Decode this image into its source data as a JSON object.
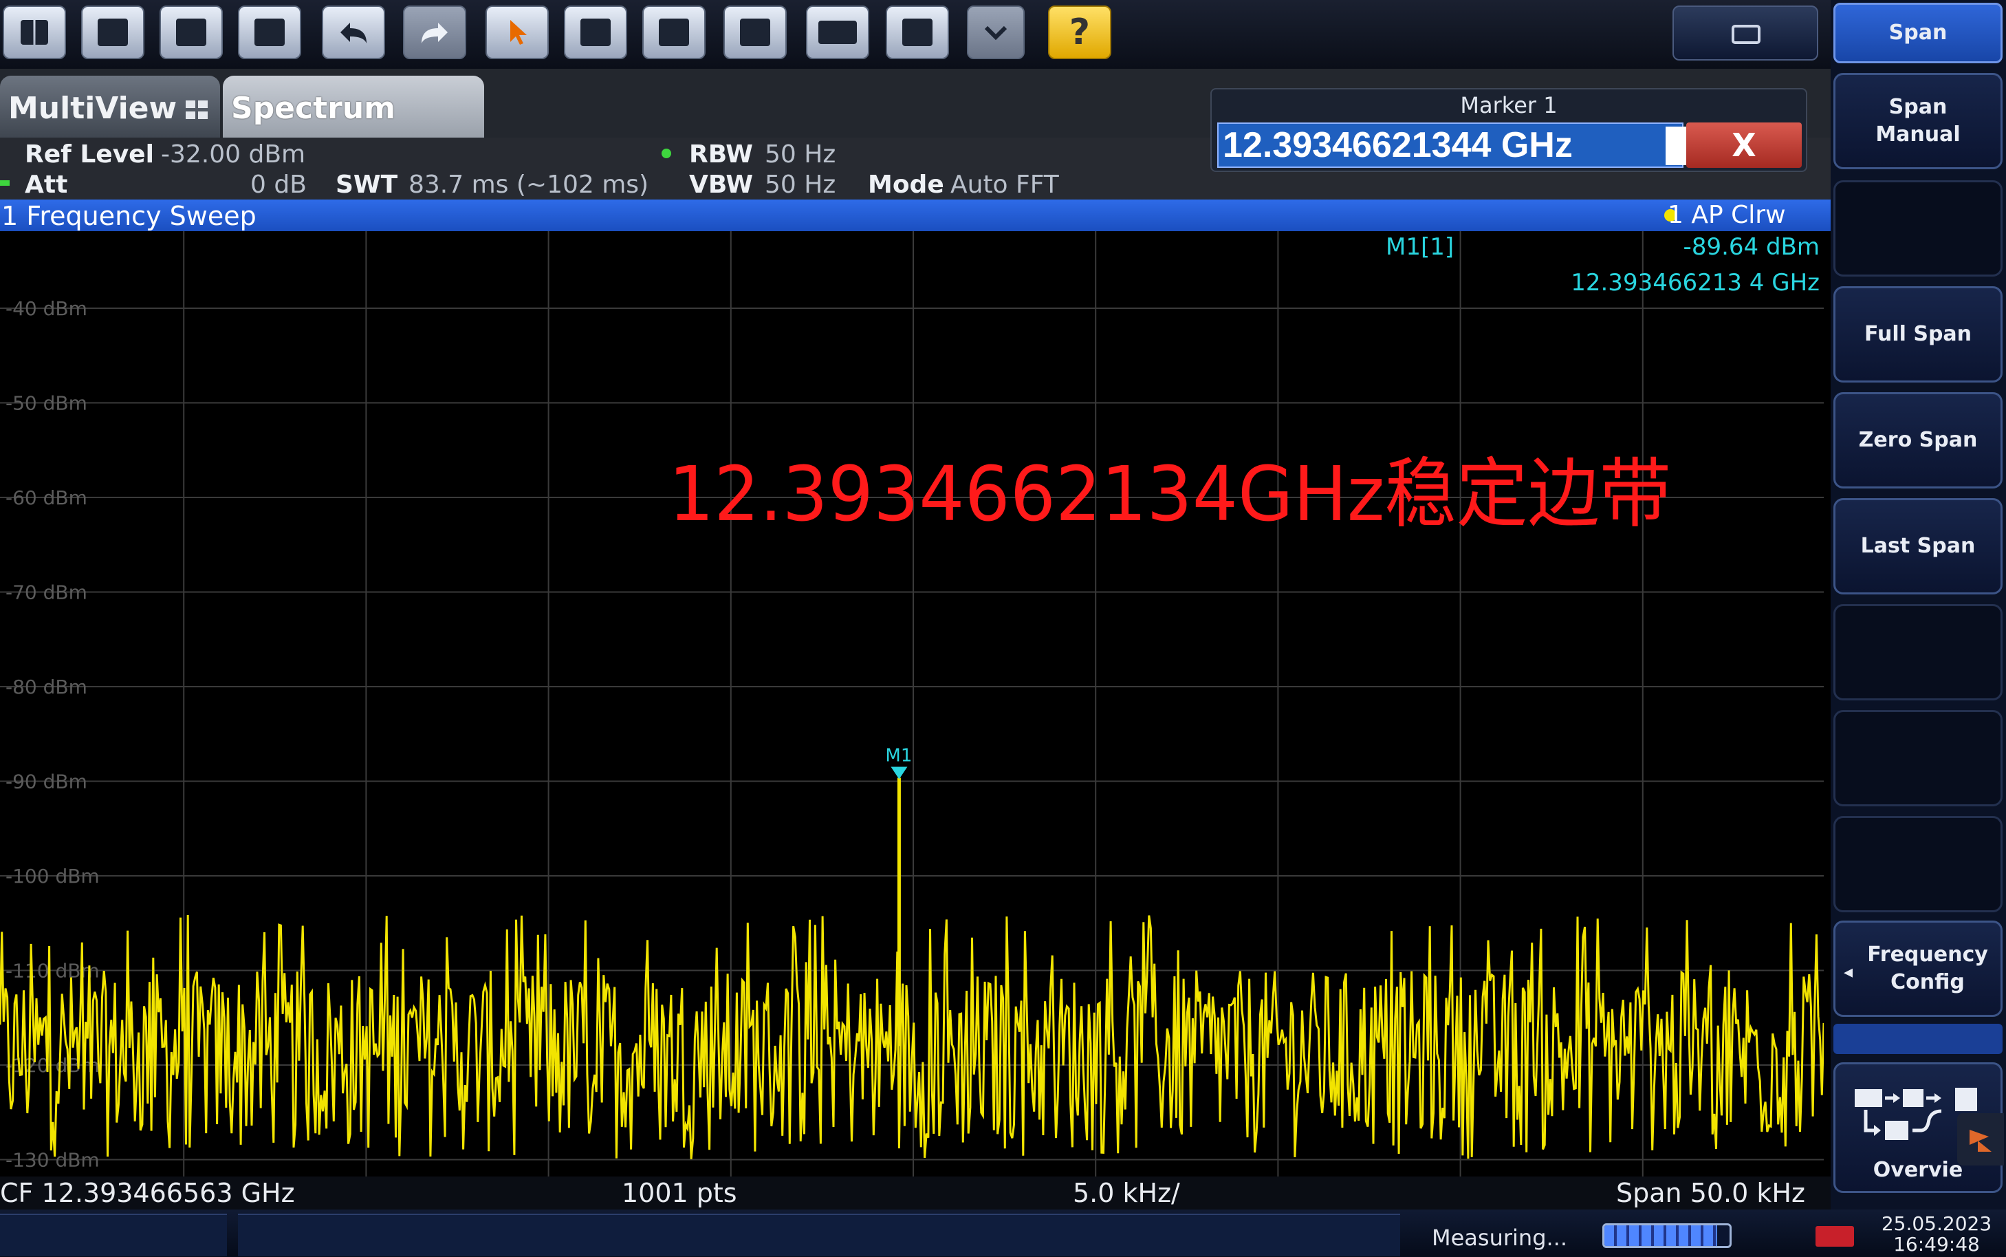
{
  "toolbar": {
    "buttons": [
      "windows-icon",
      "open-icon",
      "save-icon",
      "print-icon",
      "undo-icon",
      "redo-icon",
      "select-arrow-icon",
      "zoom-icon",
      "zoom-multi-icon",
      "zoom-off-icon",
      "keyboard-icon",
      "connect-icon",
      "more-icon",
      "help-icon"
    ]
  },
  "tabs": {
    "multiview": "MultiView",
    "spectrum": "Spectrum"
  },
  "marker_editor": {
    "title": "Marker 1",
    "value": "12.39346621344 GHz",
    "close": "X"
  },
  "settings": {
    "ref_level_label": "Ref Level",
    "ref_level_value": "-32.00 dBm",
    "att_label": "Att",
    "att_value": "0 dB",
    "swt_label": "SWT",
    "swt_value": "83.7 ms (~102 ms)",
    "rbw_label": "RBW",
    "rbw_value": "50 Hz",
    "vbw_label": "VBW",
    "vbw_value": "50 Hz",
    "mode_label": "Mode",
    "mode_value": "Auto FFT"
  },
  "window": {
    "title": "1 Frequency Sweep",
    "trace_info": "1 AP Clrw"
  },
  "marker_readout": {
    "name": "M1[1]",
    "level": "-89.64 dBm",
    "frequency": "12.393466213 4 GHz",
    "label_on_trace": "M1"
  },
  "annotation": "12.3934662134GHz稳定边带",
  "colors": {
    "trace": "#f2e400",
    "marker": "#2ad6e0",
    "annotation": "#ff1a1a",
    "title_bar": "#2461dd"
  },
  "chart_data": {
    "type": "line",
    "y_ticks": [
      "-40 dBm",
      "-50 dBm",
      "-60 dBm",
      "-70 dBm",
      "-80 dBm",
      "-90 dBm",
      "-100 dBm",
      "-110 dBm",
      "-120 dBm",
      "-130 dBm"
    ],
    "ylim": [
      -134,
      -32
    ],
    "xlim_khz": [
      -25,
      25
    ],
    "center_frequency": "12.393466563 GHz",
    "span": "50.0 kHz",
    "points": 1001,
    "peak": {
      "x_khz": -0.35,
      "y_dbm": -89.64
    },
    "noise_floor_dbm": [
      -130,
      -110
    ],
    "grid": true
  },
  "footer": {
    "cf": "CF 12.393466563 GHz",
    "pts": "1001 pts",
    "div": "5.0 kHz/",
    "span": "Span 50.0 kHz"
  },
  "softkeys": {
    "header": "Span",
    "span_manual": "Span Manual",
    "full_span": "Full Span",
    "zero_span": "Zero Span",
    "last_span": "Last Span",
    "frequency_config": "Frequency Config",
    "overview": "Overvie"
  },
  "status": {
    "measuring": "Measuring...",
    "progress": 0.9,
    "date": "25.05.2023",
    "time": "16:49:48"
  }
}
